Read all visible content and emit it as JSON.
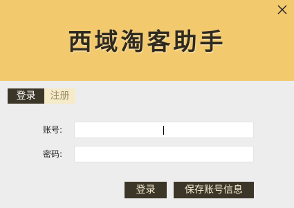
{
  "window": {
    "title": "西域淘客助手",
    "close_icon": "close-icon"
  },
  "colors": {
    "header_bg": "#f2c96d",
    "body_bg": "#ededed",
    "dark_button": "#3c3628",
    "inactive_tab": "#f5ebc8"
  },
  "tabs": [
    {
      "label": "登录",
      "active": true
    },
    {
      "label": "注册",
      "active": false
    }
  ],
  "form": {
    "account_label": "账号:",
    "account_value": "",
    "password_label": "密码:",
    "password_value": ""
  },
  "buttons": {
    "login_label": "登录",
    "save_label": "保存账号信息"
  }
}
